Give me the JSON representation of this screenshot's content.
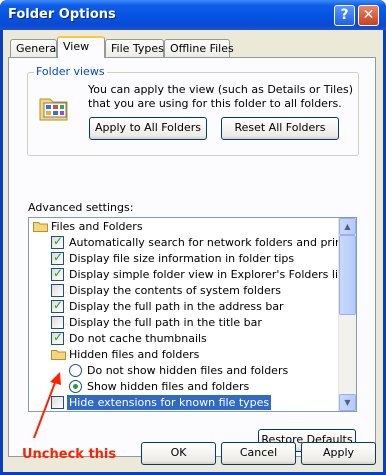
{
  "window": {
    "title": "Folder Options",
    "help_glyph": "?",
    "close_glyph": "✕"
  },
  "tabs": [
    "General",
    "View",
    "File Types",
    "Offline Files"
  ],
  "active_tab": "View",
  "folder_views": {
    "legend": "Folder views",
    "description": "You can apply the view (such as Details or Tiles) that you are using for this folder to all folders.",
    "apply_button": "Apply to All Folders",
    "reset_button": "Reset All Folders"
  },
  "advanced": {
    "label": "Advanced settings:",
    "items": [
      {
        "type": "folder",
        "label": "Files and Folders",
        "indent": 0
      },
      {
        "type": "checkbox",
        "label": "Automatically search for network folders and printers",
        "checked": true,
        "indent": 1
      },
      {
        "type": "checkbox",
        "label": "Display file size information in folder tips",
        "checked": true,
        "indent": 1
      },
      {
        "type": "checkbox",
        "label": "Display simple folder view in Explorer's Folders list",
        "checked": true,
        "indent": 1
      },
      {
        "type": "checkbox",
        "label": "Display the contents of system folders",
        "checked": false,
        "indent": 1
      },
      {
        "type": "checkbox",
        "label": "Display the full path in the address bar",
        "checked": true,
        "indent": 1
      },
      {
        "type": "checkbox",
        "label": "Display the full path in the title bar",
        "checked": false,
        "indent": 1
      },
      {
        "type": "checkbox",
        "label": "Do not cache thumbnails",
        "checked": true,
        "indent": 1
      },
      {
        "type": "folder",
        "label": "Hidden files and folders",
        "indent": 1
      },
      {
        "type": "radio",
        "label": "Do not show hidden files and folders",
        "checked": false,
        "indent": 2
      },
      {
        "type": "radio",
        "label": "Show hidden files and folders",
        "checked": true,
        "indent": 2
      },
      {
        "type": "checkbox",
        "label": "Hide extensions for known file types",
        "checked": false,
        "indent": 1,
        "selected": true
      }
    ],
    "restore_button": "Restore Defaults"
  },
  "annotation": {
    "text": "Uncheck this",
    "color": "#ff2200"
  },
  "footer": {
    "ok": "OK",
    "cancel": "Cancel",
    "apply": "Apply"
  },
  "colors": {
    "title_bar": "#0553e1",
    "selection": "#316ac5",
    "dialog_bg": "#ece9d8"
  }
}
